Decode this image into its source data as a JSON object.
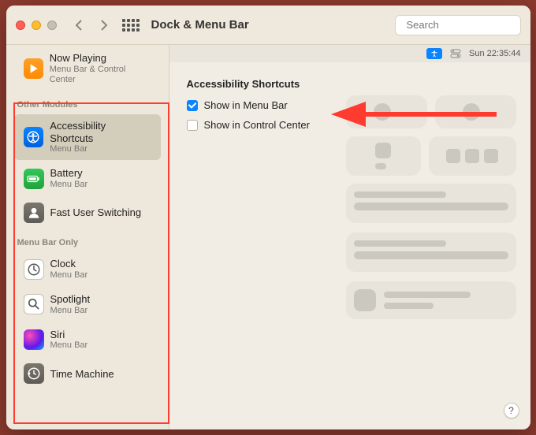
{
  "window": {
    "title": "Dock & Menu Bar"
  },
  "search": {
    "placeholder": "Search"
  },
  "menubar_preview": {
    "time": "Sun 22:35:44"
  },
  "sidebar": {
    "now_playing": {
      "name": "Now Playing",
      "sub": "Menu Bar & Control Center"
    },
    "section_other": "Other Modules",
    "accessibility": {
      "name": "Accessibility Shortcuts",
      "sub": "Menu Bar"
    },
    "battery": {
      "name": "Battery",
      "sub": "Menu Bar"
    },
    "fus": {
      "name": "Fast User Switching"
    },
    "section_mbonly": "Menu Bar Only",
    "clock": {
      "name": "Clock",
      "sub": "Menu Bar"
    },
    "spotlight": {
      "name": "Spotlight",
      "sub": "Menu Bar"
    },
    "siri": {
      "name": "Siri",
      "sub": "Menu Bar"
    },
    "tm": {
      "name": "Time Machine"
    }
  },
  "main": {
    "heading": "Accessibility Shortcuts",
    "option_menu_bar": "Show in Menu Bar",
    "option_control_center": "Show in Control Center"
  },
  "help": {
    "label": "?"
  }
}
